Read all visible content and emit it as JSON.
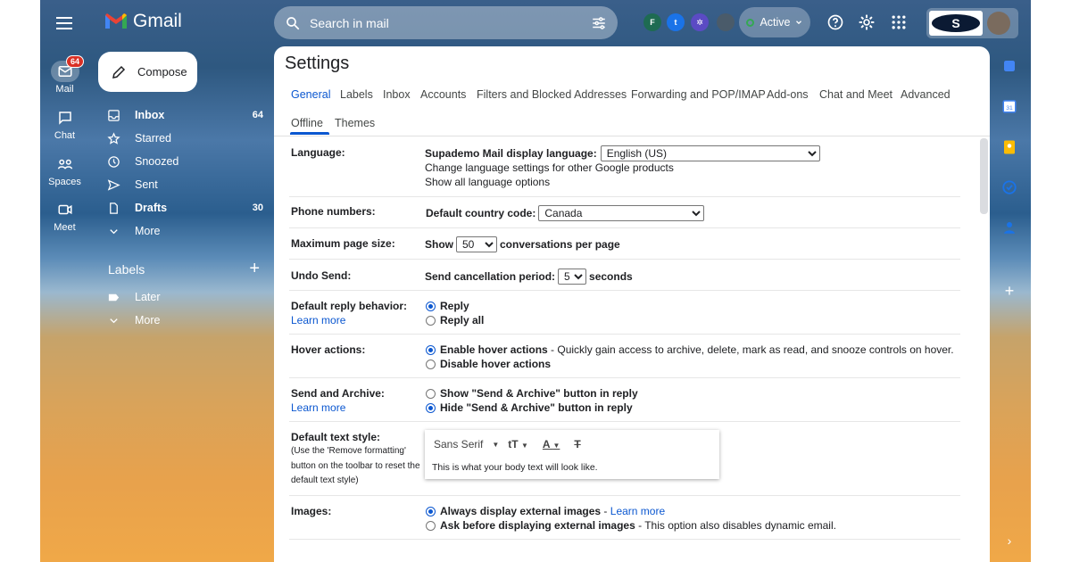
{
  "app": {
    "name": "Gmail"
  },
  "rail": {
    "mail_label": "Mail",
    "mail_badge": "64",
    "chat_label": "Chat",
    "spaces_label": "Spaces",
    "meet_label": "Meet"
  },
  "nav": {
    "compose": "Compose",
    "items": [
      {
        "label": "Inbox",
        "count": "64"
      },
      {
        "label": "Starred",
        "count": ""
      },
      {
        "label": "Snoozed",
        "count": ""
      },
      {
        "label": "Sent",
        "count": ""
      },
      {
        "label": "Drafts",
        "count": "30"
      },
      {
        "label": "More",
        "count": ""
      }
    ],
    "labels_title": "Labels",
    "label_items": [
      {
        "label": "Later"
      },
      {
        "label": "More"
      }
    ]
  },
  "search": {
    "placeholder": "Search in mail"
  },
  "topbar": {
    "apps": [
      {
        "letter": "F",
        "color": "#1e6b52"
      },
      {
        "letter": "t",
        "color": "#1a73e8"
      },
      {
        "letter": "✲",
        "color": "#5b4bc4"
      },
      {
        "letter": "",
        "color": "#4a5b6a"
      }
    ],
    "status": "Active",
    "account_logo_letter": "S"
  },
  "settings": {
    "title": "Settings",
    "tabs": [
      "General",
      "Labels",
      "Inbox",
      "Accounts",
      "Filters and Blocked Addresses",
      "Forwarding and POP/IMAP",
      "Add-ons",
      "Chat and Meet",
      "Advanced",
      "Offline",
      "Themes"
    ],
    "language": {
      "label": "Language:",
      "display_label": "Supademo Mail display language:",
      "value": "English (US)",
      "link1": "Change language settings for other Google products",
      "link2": "Show all language options"
    },
    "phone": {
      "label": "Phone numbers:",
      "field": "Default country code:",
      "value": "Canada"
    },
    "page_size": {
      "label": "Maximum page size:",
      "prefix": "Show",
      "value": "50",
      "suffix": "conversations per page"
    },
    "undo": {
      "label": "Undo Send:",
      "prefix": "Send cancellation period:",
      "value": "5",
      "suffix": "seconds"
    },
    "reply": {
      "label": "Default reply behavior:",
      "learn": "Learn more",
      "opt1": "Reply",
      "opt2": "Reply all"
    },
    "hover": {
      "label": "Hover actions:",
      "opt1": "Enable hover actions",
      "opt1_desc": " - Quickly gain access to archive, delete, mark as read, and snooze controls on hover.",
      "opt2": "Disable hover actions"
    },
    "send_archive": {
      "label": "Send and Archive:",
      "learn": "Learn more",
      "opt1": "Show \"Send & Archive\" button in reply",
      "opt2": "Hide \"Send & Archive\" button in reply"
    },
    "text_style": {
      "label": "Default text style:",
      "note": "(Use the 'Remove formatting' button on the toolbar to reset the default text style)",
      "font": "Sans Serif",
      "sample": "This is what your body text will look like."
    },
    "images": {
      "label": "Images:",
      "opt1": "Always display external images",
      "opt1_sep": " - ",
      "opt1_link": "Learn more",
      "opt2": "Ask before displaying external images",
      "opt2_desc": " - This option also disables dynamic email."
    }
  }
}
